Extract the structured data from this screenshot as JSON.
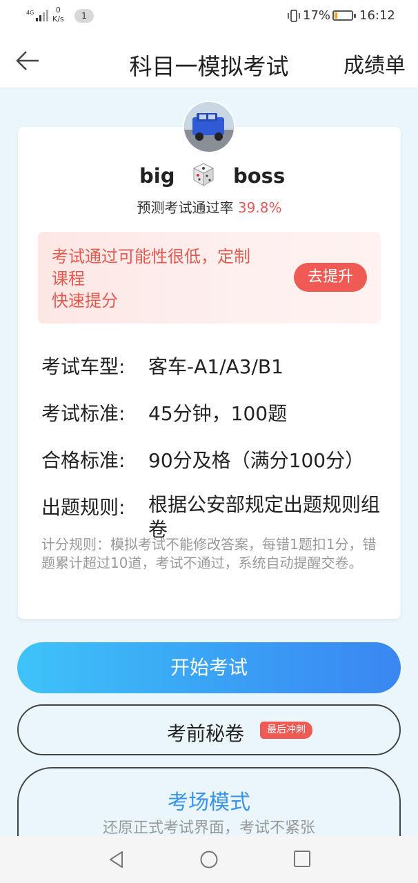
{
  "status_bar": {
    "network": "4G",
    "speed_value": "0",
    "speed_unit": "K/s",
    "notification_count": "1",
    "battery_percent": "17%",
    "battery_level": 0.17,
    "time": "16:12"
  },
  "header": {
    "title": "科目一模拟考试",
    "report_label": "成绩单"
  },
  "user": {
    "name_first": "big",
    "name_last": "boss",
    "pass_rate_label": "预测考试通过率",
    "pass_rate_value": "39.8%"
  },
  "alert": {
    "line1": "考试通过可能性很低，定制",
    "line2": "课程",
    "line3": "快速提分",
    "button_label": "去提升"
  },
  "exam_info": [
    {
      "label": "考试车型:",
      "value": "客车-A1/A3/B1"
    },
    {
      "label": "考试标准:",
      "value": "45分钟，100题"
    },
    {
      "label": "合格标准:",
      "value": "90分及格（满分100分）"
    },
    {
      "label": "出题规则:",
      "value": "根据公安部规定出题规则组卷"
    }
  ],
  "score_rule": "计分规则：模拟考试不能修改答案，每错1题扣1分，错题累计超过10道，考试不通过，系统自动提醒交卷。",
  "buttons": {
    "start_label": "开始考试",
    "secret_label": "考前秘卷",
    "secret_badge": "最后冲刺",
    "exam_mode_title": "考场模式",
    "exam_mode_subtitle": "还原正式考试界面，考试不紧张"
  },
  "colors": {
    "accent_red": "#ef5a54",
    "accent_blue": "#3a95e8",
    "start_gradient_from": "#3ec3f8",
    "start_gradient_to": "#3a86f2"
  },
  "icons": {
    "back": "arrow-left-icon",
    "dice": "dice-icon",
    "nav_back": "triangle-back-icon",
    "nav_home": "circle-home-icon",
    "nav_recent": "square-recent-icon"
  }
}
